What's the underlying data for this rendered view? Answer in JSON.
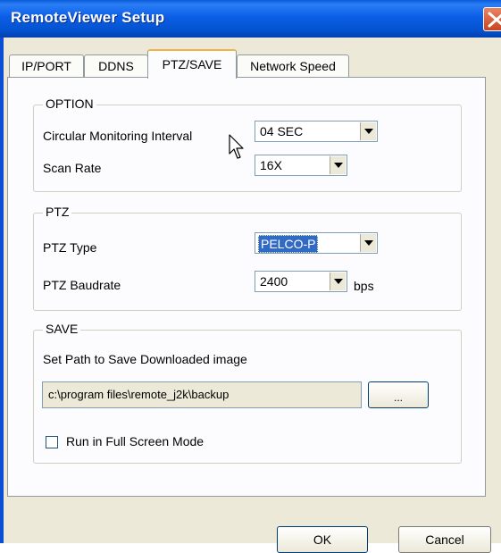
{
  "window": {
    "title": "RemoteViewer Setup"
  },
  "tabs": [
    {
      "label": "IP/PORT",
      "active": false
    },
    {
      "label": "DDNS",
      "active": false
    },
    {
      "label": "PTZ/SAVE",
      "active": true
    },
    {
      "label": "Network Speed",
      "active": false
    }
  ],
  "option": {
    "title": "OPTION",
    "interval_label": "Circular Monitoring Interval",
    "interval_value": "04 SEC",
    "scan_label": "Scan Rate",
    "scan_value": "16X"
  },
  "ptz": {
    "title": "PTZ",
    "type_label": "PTZ Type",
    "type_value": "PELCO-P",
    "baud_label": "PTZ Baudrate",
    "baud_value": "2400",
    "baud_unit": "bps"
  },
  "save": {
    "title": "SAVE",
    "path_label": "Set Path to Save Downloaded image",
    "path_value": "c:\\program files\\remote_j2k\\backup",
    "browse_label": "...",
    "fullscreen_label": "Run in Full Screen Mode",
    "fullscreen_checked": false
  },
  "buttons": {
    "ok": "OK",
    "cancel": "Cancel"
  },
  "colors": {
    "titlebar": "#0453d0",
    "selection": "#316ac5",
    "close": "#c84520"
  }
}
